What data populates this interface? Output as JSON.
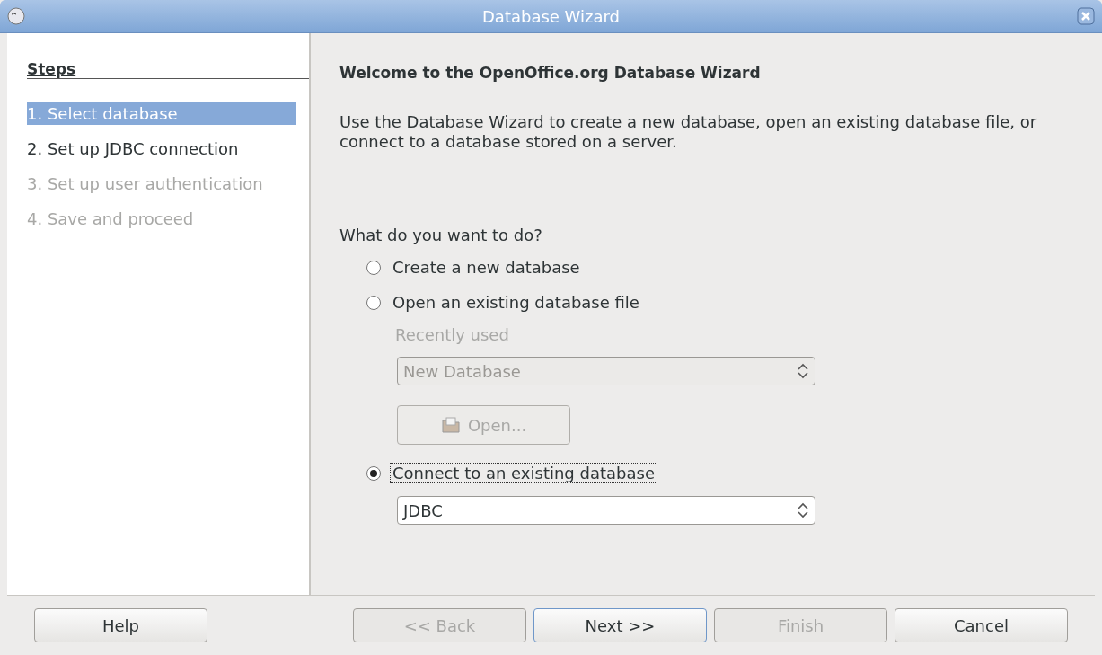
{
  "window": {
    "title": "Database Wizard"
  },
  "steps": {
    "heading": "Steps",
    "items": [
      {
        "label": "1. Select database",
        "selected": true,
        "disabled": false
      },
      {
        "label": "2. Set up JDBC connection",
        "selected": false,
        "disabled": false
      },
      {
        "label": "3. Set up user authentication",
        "selected": false,
        "disabled": true
      },
      {
        "label": "4. Save and proceed",
        "selected": false,
        "disabled": true
      }
    ]
  },
  "page": {
    "title": "Welcome to the OpenOffice.org Database Wizard",
    "description": "Use the Database Wizard to create a new database, open an existing database file, or connect to a database stored on a server.",
    "question": "What do you want to do?",
    "options": [
      {
        "kind": "radio",
        "label": "Create a new database",
        "selected": false
      },
      {
        "kind": "radio",
        "label": "Open an existing database file",
        "selected": false
      },
      {
        "kind": "label",
        "label": "Recently used",
        "disabled": true
      },
      {
        "kind": "dropdown",
        "value": "New Database",
        "disabled": true
      },
      {
        "kind": "button",
        "label": "Open...",
        "disabled": true
      },
      {
        "kind": "radio",
        "label": "Connect to an existing database",
        "selected": true
      },
      {
        "kind": "dropdown",
        "value": "JDBC",
        "disabled": false
      }
    ]
  },
  "buttons": [
    {
      "label": "Help",
      "disabled": false,
      "default": false
    },
    {
      "label": "<< Back",
      "disabled": true,
      "default": false
    },
    {
      "label": "Next >>",
      "disabled": false,
      "default": true
    },
    {
      "label": "Finish",
      "disabled": true,
      "default": false
    },
    {
      "label": "Cancel",
      "disabled": false,
      "default": false
    }
  ]
}
